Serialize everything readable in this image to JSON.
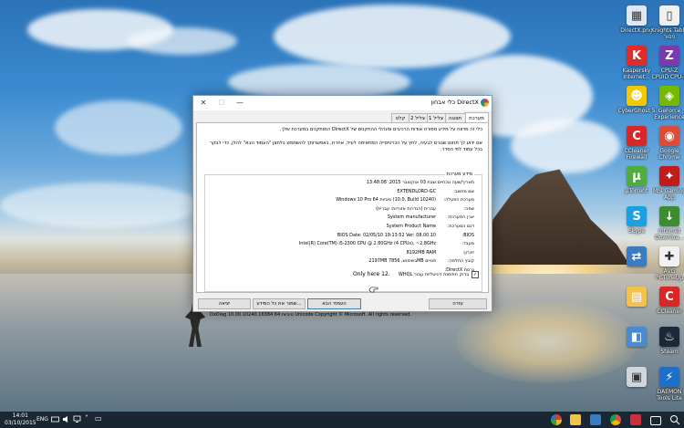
{
  "desktop": {
    "icons_col1": [
      {
        "label": "DirectX.png",
        "icon": "image-file-icon",
        "color": "#dfe8f2",
        "glyph": "▦"
      },
      {
        "label": "Kaspersky\nInternet...",
        "icon": "kaspersky-icon",
        "color": "#e02b2b",
        "glyph": "K"
      },
      {
        "label": "CyberGhost 5",
        "icon": "cyberghost-icon",
        "color": "#f2c800",
        "glyph": "☻"
      },
      {
        "label": "CCleaner\nFirewall",
        "icon": "ccleaner-icon",
        "color": "#d92727",
        "glyph": "C"
      },
      {
        "label": "µTorrent",
        "icon": "utorrent-icon",
        "color": "#4fae3b",
        "glyph": "µ"
      },
      {
        "label": "Skype",
        "icon": "skype-icon",
        "color": "#1ba1e2",
        "glyph": "S"
      },
      {
        "label": "",
        "icon": "network-icon",
        "color": "#3a7cc4",
        "glyph": "⇄"
      },
      {
        "label": "",
        "icon": "folder-icon",
        "color": "#f3c24b",
        "glyph": "▤"
      },
      {
        "label": "",
        "icon": "app-icon",
        "color": "#4a8ad0",
        "glyph": "◧"
      },
      {
        "label": "",
        "icon": "app-icon-2",
        "color": "#cfd6de",
        "glyph": "▣"
      }
    ],
    "icons_col2": [
      {
        "label": "Knights Table\nפסור",
        "icon": "document-icon",
        "color": "#f0f0f0",
        "glyph": "▯"
      },
      {
        "label": "CPU-Z\nCPUID CPU-Z",
        "icon": "cpuz-icon",
        "color": "#7a3ab0",
        "glyph": "Z"
      },
      {
        "label": "GeForce\nExperience",
        "icon": "geforce-icon",
        "color": "#76b900",
        "glyph": "◈"
      },
      {
        "label": "Google\nChrome",
        "icon": "chrome-icon",
        "color": "#dd4b39",
        "glyph": "◉"
      },
      {
        "label": "MSI Gaming\nApp",
        "icon": "msi-icon",
        "color": "#c21b1b",
        "glyph": "✦"
      },
      {
        "label": "Internet\nDownloa...",
        "icon": "idm-icon",
        "color": "#3c8d2f",
        "glyph": "↓"
      },
      {
        "label": "AVG\nPCTuneUp",
        "icon": "avg-icon",
        "color": "#f1f1f1",
        "glyph": "✚"
      },
      {
        "label": "CCleaner",
        "icon": "ccleaner2-icon",
        "color": "#d92727",
        "glyph": "C"
      },
      {
        "label": "Steam",
        "icon": "steam-icon",
        "color": "#1b2838",
        "glyph": "♨"
      },
      {
        "label": "DAEMON\nTools Lite",
        "icon": "daemon-icon",
        "color": "#1e6fc9",
        "glyph": "⚡"
      }
    ],
    "icons_col1_bottom": [
      "סל המיחזור",
      "מאשר"
    ]
  },
  "dialog": {
    "title": "כלי אבחון DirectX",
    "tabs": [
      "מערכת",
      "תצוגה",
      "צליל 1",
      "צליל 2",
      "קלט"
    ],
    "intro_1": "כלי זה מדווח על מידע מפורט אודות הרכיבים ומנהלי ההתקנים של DirectX המותקנים במערכת שלך.",
    "intro_2": "אם ידוע לך תחום שגורם לבעיה, לחץ על הכרטיסייה המתאימה לעיל. אחרת, באפשרותך להשתמש בלחצן \"העמוד הבא\" להלן, כדי לבקר בכל עמוד לפי הסדר.",
    "system_info_label": "מידע מערכת",
    "rows": [
      {
        "key": "תאריך/שעה נוכחיים:",
        "value": "שבת 03 אוקטובר 2015, 13:48:08"
      },
      {
        "key": "שם מחשב:",
        "value": "EXTENDLORD-GC"
      },
      {
        "key": "מערכת הפעלה:",
        "value": "Windows 10 Pro 64 סיביות (10.0, Build 10240)"
      },
      {
        "key": "שפה:",
        "value": "עברית (הגדרות אזוריות: עברית)"
      },
      {
        "key": "יצרן המערכת:",
        "value": "System manufacturer"
      },
      {
        "key": "דגם המערכת:",
        "value": "System Product Name"
      },
      {
        "key": "BIOS:",
        "value": "BIOS Date: 02/05/10 19:13:52 Ver: 08.00.10"
      },
      {
        "key": "מעבד:",
        "value": "Intel(R) Core(TM) i5-2300 CPU @ 2.80GHz (4 CPUs), ~2.8GHz"
      },
      {
        "key": "זיכרון:",
        "value": "8192MB RAM"
      },
      {
        "key": "קובץ החלפה:",
        "value": "2197MB בשימוש, 7856MB פנויים"
      },
      {
        "key": "גרסת DirectX:",
        "value": ""
      }
    ],
    "whql_label": "בדוק חתימות דיגיטליות עבור WHQL",
    "whql_checked": "✓",
    "only_here": "Only here 12.",
    "footer": "DxDiag 10.00.10240.16384 64 סיביות Unicode  Copyright © Microsoft. All rights reserved.",
    "buttons": {
      "help": "עזרה",
      "next": "העמוד הבא",
      "save": "שמור את כל המידע...",
      "exit": "יציאה"
    }
  },
  "taskbar": {
    "time": "14:01",
    "date": "03/10/2015",
    "lang": "ENG"
  }
}
